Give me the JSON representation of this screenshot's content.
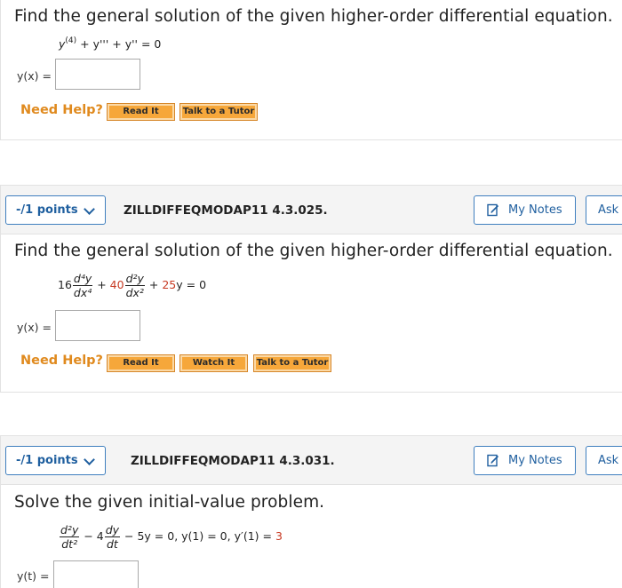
{
  "q1": {
    "prompt": "Find the general solution of the given higher-order differential equation.",
    "eq_y": "y",
    "eq_sup": "(4)",
    "eq_rest": " + y''' + y'' = 0",
    "answer_label": "y(x) =",
    "answer_value": "",
    "need_help": "Need Help?",
    "buttons": [
      "Read It",
      "Talk to a Tutor"
    ]
  },
  "q2": {
    "points": "-/1 points",
    "question_id": "ZILLDIFFEQMODAP11 4.3.025.",
    "my_notes": "My Notes",
    "ask": "Ask Y",
    "prompt": "Find the general solution of the given higher-order differential equation.",
    "coef1": "16",
    "frac1_num": "d⁴y",
    "frac1_den": "dx⁴",
    "plus1": " + ",
    "coef2": "40",
    "frac2_num": "d²y",
    "frac2_den": "dx²",
    "plus2": " + ",
    "coef3": "25",
    "tail": "y = 0",
    "answer_label": "y(x) =",
    "answer_value": "",
    "need_help": "Need Help?",
    "buttons": [
      "Read It",
      "Watch It",
      "Talk to a Tutor"
    ]
  },
  "q3": {
    "points": "-/1 points",
    "question_id": "ZILLDIFFEQMODAP11 4.3.031.",
    "my_notes": "My Notes",
    "ask": "Ask Y",
    "prompt": "Solve the given initial-value problem.",
    "frac1_num": "d²y",
    "frac1_den": "dt²",
    "mid1": " − 4",
    "frac2_num": "dy",
    "frac2_den": "dt",
    "mid2": " − 5y = 0,  y(1) = 0, y′(1) = ",
    "ic_value": "3",
    "answer_label": "y(t) =",
    "answer_value": ""
  },
  "colors": {
    "accent_blue": "#1f5f9f",
    "help_orange": "#e08a1e",
    "button_orange": "#f6a73a",
    "red_value": "#c83a23"
  },
  "icons": {
    "notes": "pencil-note-icon",
    "points_dropdown": "chevron-down-icon"
  }
}
